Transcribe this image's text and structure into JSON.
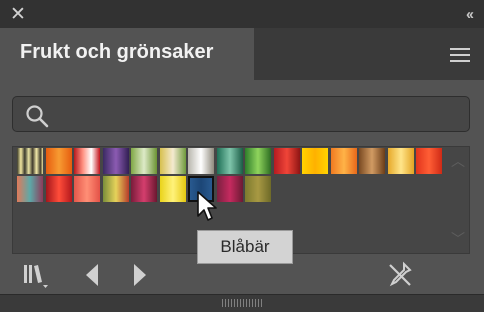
{
  "panel": {
    "title": "Frukt och grönsaker",
    "search_placeholder": "",
    "tooltip": "Blåbär"
  },
  "icons": {
    "close": "close-icon",
    "collapse": "double-chevron-icon",
    "menu": "hamburger-menu-icon",
    "search": "search-icon",
    "libraries": "libraries-icon",
    "prev": "previous-arrow-icon",
    "next": "next-arrow-icon",
    "eyedropper": "eyedropper-disabled-icon"
  },
  "swatches_row1": [
    "linear-gradient(90deg,#3a3a2a,#f1e7a0 15%,#3b3b2e 30%,#e9e4a4 45%,#403a2c 60%,#f4eaa9 75%,#413b2c 90%,#f0e7a0)",
    "linear-gradient(90deg,#e65c0f,#f79b32,#e65c0f)",
    "linear-gradient(90deg,#b6191e,#ff8f7f,#fff,#c4121a)",
    "linear-gradient(90deg,#3b2a62,#8b5bb2,#321f54)",
    "linear-gradient(90deg,#7fa745,#ddeac7,#6b9333)",
    "linear-gradient(90deg,#d7c04e,#f4ead0,#6e9a3b)",
    "linear-gradient(90deg,#b8b6ad,#ffffff,#8f8a7d)",
    "linear-gradient(90deg,#1e6f56,#7fc5ab,#1a5c45)",
    "linear-gradient(90deg,#2e7d2a,#8fd45d,#2d6d22)",
    "linear-gradient(90deg,#b51b21,#f04538,#8f1514)",
    "linear-gradient(90deg,#ffd400,#ffb100,#ffd400)",
    "linear-gradient(90deg,#f07a21,#ffb347,#e8681a)",
    "linear-gradient(90deg,#7a4a22,#d19b63,#6b3d18)",
    "linear-gradient(90deg,#e6a92a,#ffe58a,#e3a323)",
    "linear-gradient(90deg,#e1341c,#ff5e35,#cf2a16)"
  ],
  "swatches_row2": [
    "linear-gradient(90deg,#e07a5a,#5da9a8,#8c3b5a)",
    "linear-gradient(90deg,#a3161b,#ff4d3a,#b3171c)",
    "linear-gradient(90deg,#e4574a,#ff8f76,#e45247)",
    "linear-gradient(90deg,#7a8e3a,#e6d25a,#b63b2a)",
    "linear-gradient(90deg,#7a1c3a,#d43e6d,#6b1730)",
    "linear-gradient(90deg,#e9d31a,#fff27a,#e4c810)",
    "linear-gradient(90deg,#2b5d94,#1c4676,#2b5d94)",
    "linear-gradient(90deg,#7b2040,#c52a5f,#6b1a33)",
    "linear-gradient(90deg,#7c7a2e,#a89943,#6e6a28)"
  ],
  "selected_swatch": 6
}
